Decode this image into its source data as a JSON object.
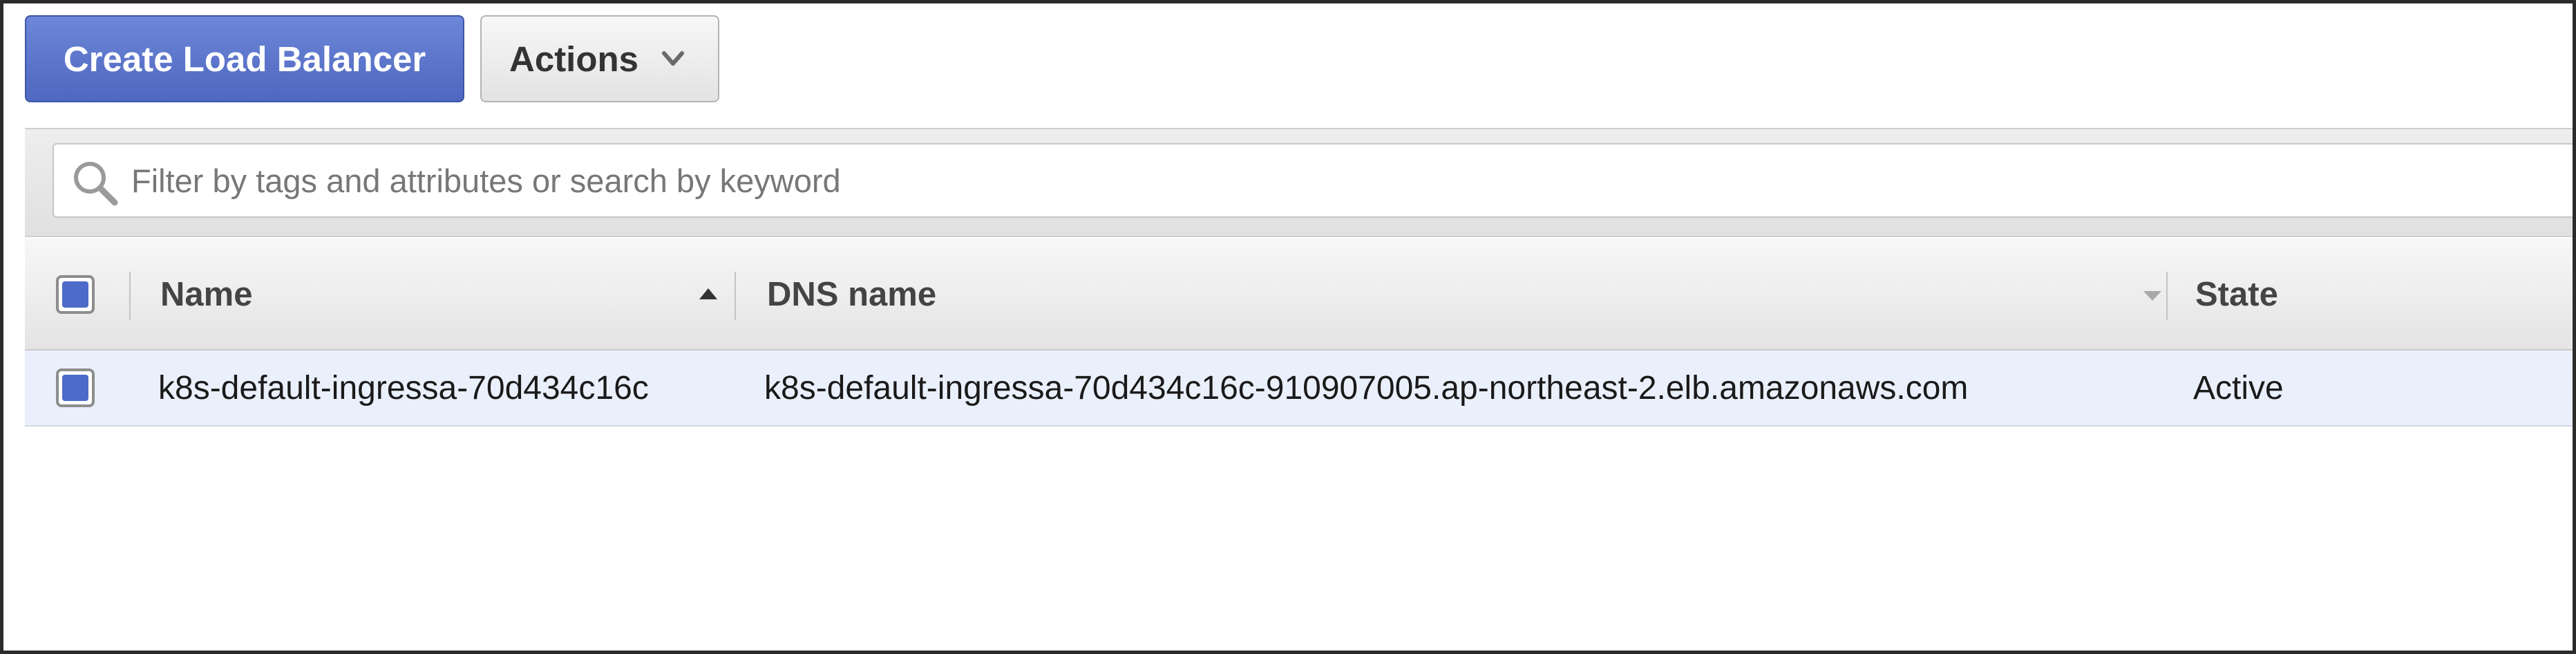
{
  "toolbar": {
    "create_label": "Create Load Balancer",
    "actions_label": "Actions",
    "actions_icon": "chevron-down-icon",
    "primary_color": "#4f67c0"
  },
  "filter": {
    "placeholder": "Filter by tags and attributes or search by keyword",
    "value": "",
    "icon": "search-icon"
  },
  "table": {
    "columns": [
      {
        "label": "Name",
        "sort": "ascending"
      },
      {
        "label": "DNS name",
        "sort": "none"
      },
      {
        "label": "State",
        "sort": "none"
      }
    ],
    "header_checkbox_checked": true,
    "rows": [
      {
        "selected": true,
        "name": "k8s-default-ingressa-70d434c16c",
        "dns_name": "k8s-default-ingressa-70d434c16c-910907005.ap-northeast-2.elb.amazonaws.com",
        "state": "Active"
      }
    ]
  },
  "colors": {
    "selected_row_bg": "#eaf0fb",
    "checkbox_fill": "#4d6ac9"
  }
}
